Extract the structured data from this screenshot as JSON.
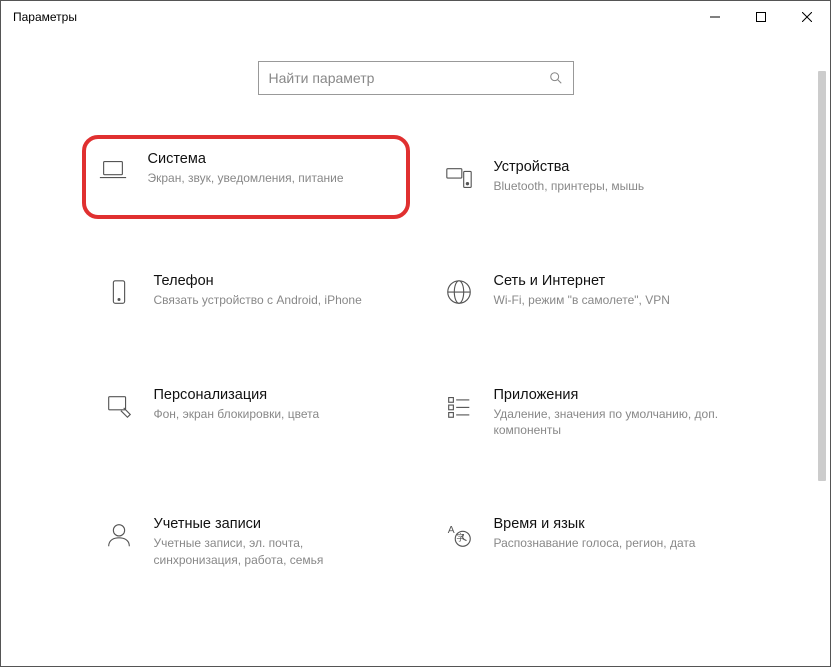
{
  "window": {
    "title": "Параметры"
  },
  "search": {
    "placeholder": "Найти параметр"
  },
  "tiles": {
    "system": {
      "title": "Система",
      "desc": "Экран, звук, уведомления, питание"
    },
    "devices": {
      "title": "Устройства",
      "desc": "Bluetooth, принтеры, мышь"
    },
    "phone": {
      "title": "Телефон",
      "desc": "Связать устройство с Android, iPhone"
    },
    "network": {
      "title": "Сеть и Интернет",
      "desc": "Wi-Fi, режим \"в самолете\", VPN"
    },
    "personalization": {
      "title": "Персонализация",
      "desc": "Фон, экран блокировки, цвета"
    },
    "apps": {
      "title": "Приложения",
      "desc": "Удаление, значения по умолчанию, доп. компоненты"
    },
    "accounts": {
      "title": "Учетные записи",
      "desc": "Учетные записи, эл. почта, синхронизация, работа, семья"
    },
    "time": {
      "title": "Время и язык",
      "desc": "Распознавание голоса, регион, дата"
    }
  }
}
